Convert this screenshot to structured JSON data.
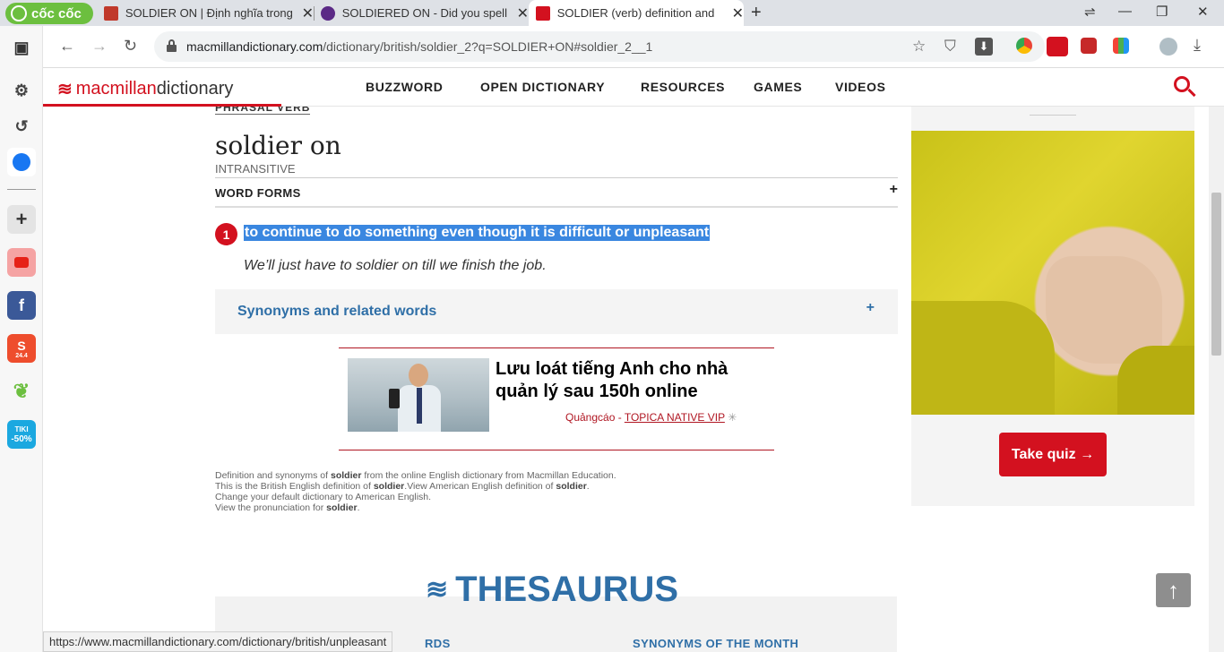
{
  "browser": {
    "brand": "cốc cốc",
    "tabs": [
      {
        "title": "SOLDIER ON | Định nghĩa trong",
        "favicon_color": "#c0392b"
      },
      {
        "title": "SOLDIERED ON - Did you spell",
        "favicon_color": "#5b2a86"
      },
      {
        "title": "SOLDIER (verb) definition and",
        "favicon_color": "#d3111f"
      }
    ],
    "new_tab": "+",
    "url_host": "macmillandictionary.com",
    "url_path": "/dictionary/british/soldier_2?q=SOLDIER+ON#soldier_2__1",
    "status_url": "https://www.macmillandictionary.com/dictionary/british/unpleasant"
  },
  "sidebar": {
    "icons": [
      "dashboard-icon",
      "settings-icon",
      "history-icon",
      "messenger-icon",
      "add-icon",
      "youtube-icon",
      "facebook-icon",
      "shopee-icon",
      "leaf-icon",
      "tiki-icon"
    ],
    "shopee_badge": "24.4",
    "tiki_label": "TIKI",
    "tiki_badge": "-50%"
  },
  "site": {
    "logo_mac": "macmillan",
    "logo_dict": "dictionary",
    "nav": [
      "BUZZWORD",
      "OPEN DICTIONARY",
      "RESOURCES",
      "GAMES",
      "VIDEOS"
    ]
  },
  "entry": {
    "phrasal_label": "PHRASAL VERB",
    "headword": "soldier on",
    "grammar": "INTRANSITIVE",
    "word_forms": "WORD FORMS",
    "sense_number": "1",
    "definition": "to continue to do something even though it is difficult or unpleasant",
    "example": "We’ll just have to soldier on till we finish the job.",
    "synonyms_label": "Synonyms and related words"
  },
  "ad": {
    "title": "Lưu loát tiếng Anh cho nhà quản lý sau 150h online",
    "label": "Quảngcáo",
    "sponsor": "TOPICA NATIVE VIP"
  },
  "footnote": {
    "line1_a": "Definition and synonyms of ",
    "line1_b": "soldier",
    "line1_c": " from the online English dictionary from Macmillan Education.",
    "line2_a": "This is the British English definition of ",
    "line2_b": "soldier",
    "line2_c": ".View American English definition of ",
    "line2_d": "soldier",
    "line2_e": ".",
    "line3": "Change your default dictionary to American English.",
    "line4_a": "View the pronunciation for ",
    "line4_b": "soldier",
    "line4_c": "."
  },
  "thesaurus": {
    "title": "THESAURUS",
    "col1": "RDS",
    "col2": "SYNONYMS OF THE MONTH"
  },
  "right": {
    "quiz_button": "Take quiz →"
  },
  "colors": {
    "brand_red": "#d3111f",
    "link_blue": "#2f6fa7",
    "selection": "#3a87e0"
  }
}
